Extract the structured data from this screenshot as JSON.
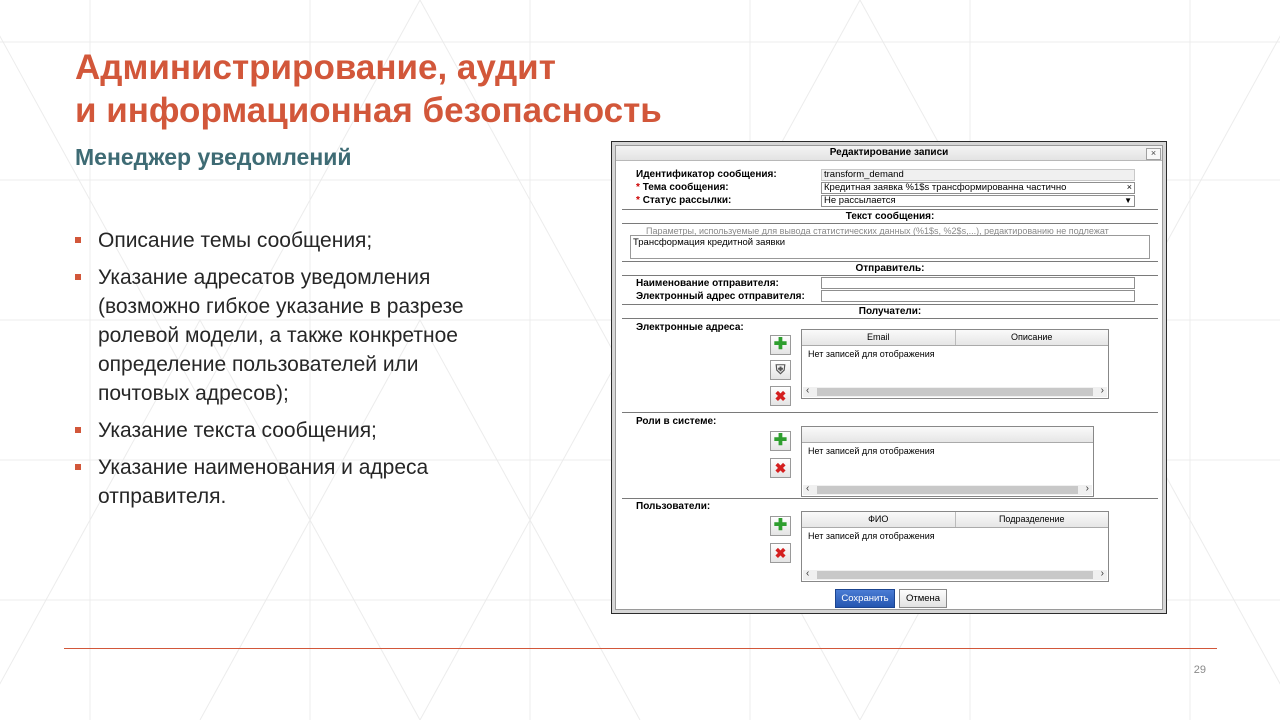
{
  "slide": {
    "title_line1": "Администрирование, аудит",
    "title_line2": "и информационная безопасность",
    "subtitle": "Менеджер уведомлений",
    "bullets": [
      "Описание темы сообщения;",
      "Указание адресатов уведомления (возможно гибкое указание в разрезе ролевой модели, а также конкретное определение пользователей или почтовых адресов);",
      "Указание текста сообщения;",
      "Указание наименования и адреса отправителя."
    ],
    "page_number": "29",
    "accent_color": "#D2573A",
    "subtitle_color": "#3E6B74"
  },
  "dialog": {
    "title": "Редактирование записи",
    "close_glyph": "×",
    "fields": {
      "message_id_label": "Идентификатор сообщения:",
      "message_id_value": "transform_demand",
      "required_mark": "*",
      "subject_label": "Тема сообщения:",
      "subject_value": "Кредитная заявка %1$s трансформированна частично",
      "clear_glyph": "×",
      "status_label": "Статус рассылки:",
      "status_value": "Не рассылается"
    },
    "message_section": {
      "title": "Текст сообщения:",
      "hint": "Параметры, используемые для вывода статистических данных (%1$s, %2$s,...), редактированию не подлежат",
      "text": "Трансформация кредитной заявки"
    },
    "sender_section": {
      "title": "Отправитель:",
      "name_label": "Наименование отправителя:",
      "email_label": "Электронный адрес отправителя:"
    },
    "recipients_section": {
      "title": "Получатели:",
      "emails_label": "Электронные адреса:",
      "emails_columns": [
        "Email",
        "Описание"
      ],
      "roles_label": "Роли в системе:",
      "users_label": "Пользователи:",
      "users_columns": [
        "ФИО",
        "Подразделение"
      ],
      "empty_text": "Нет записей для отображения"
    },
    "buttons": {
      "save": "Сохранить",
      "cancel": "Отмена"
    },
    "icons": {
      "add": "plus-icon",
      "shield": "shield-icon",
      "delete": "delete-icon"
    }
  }
}
